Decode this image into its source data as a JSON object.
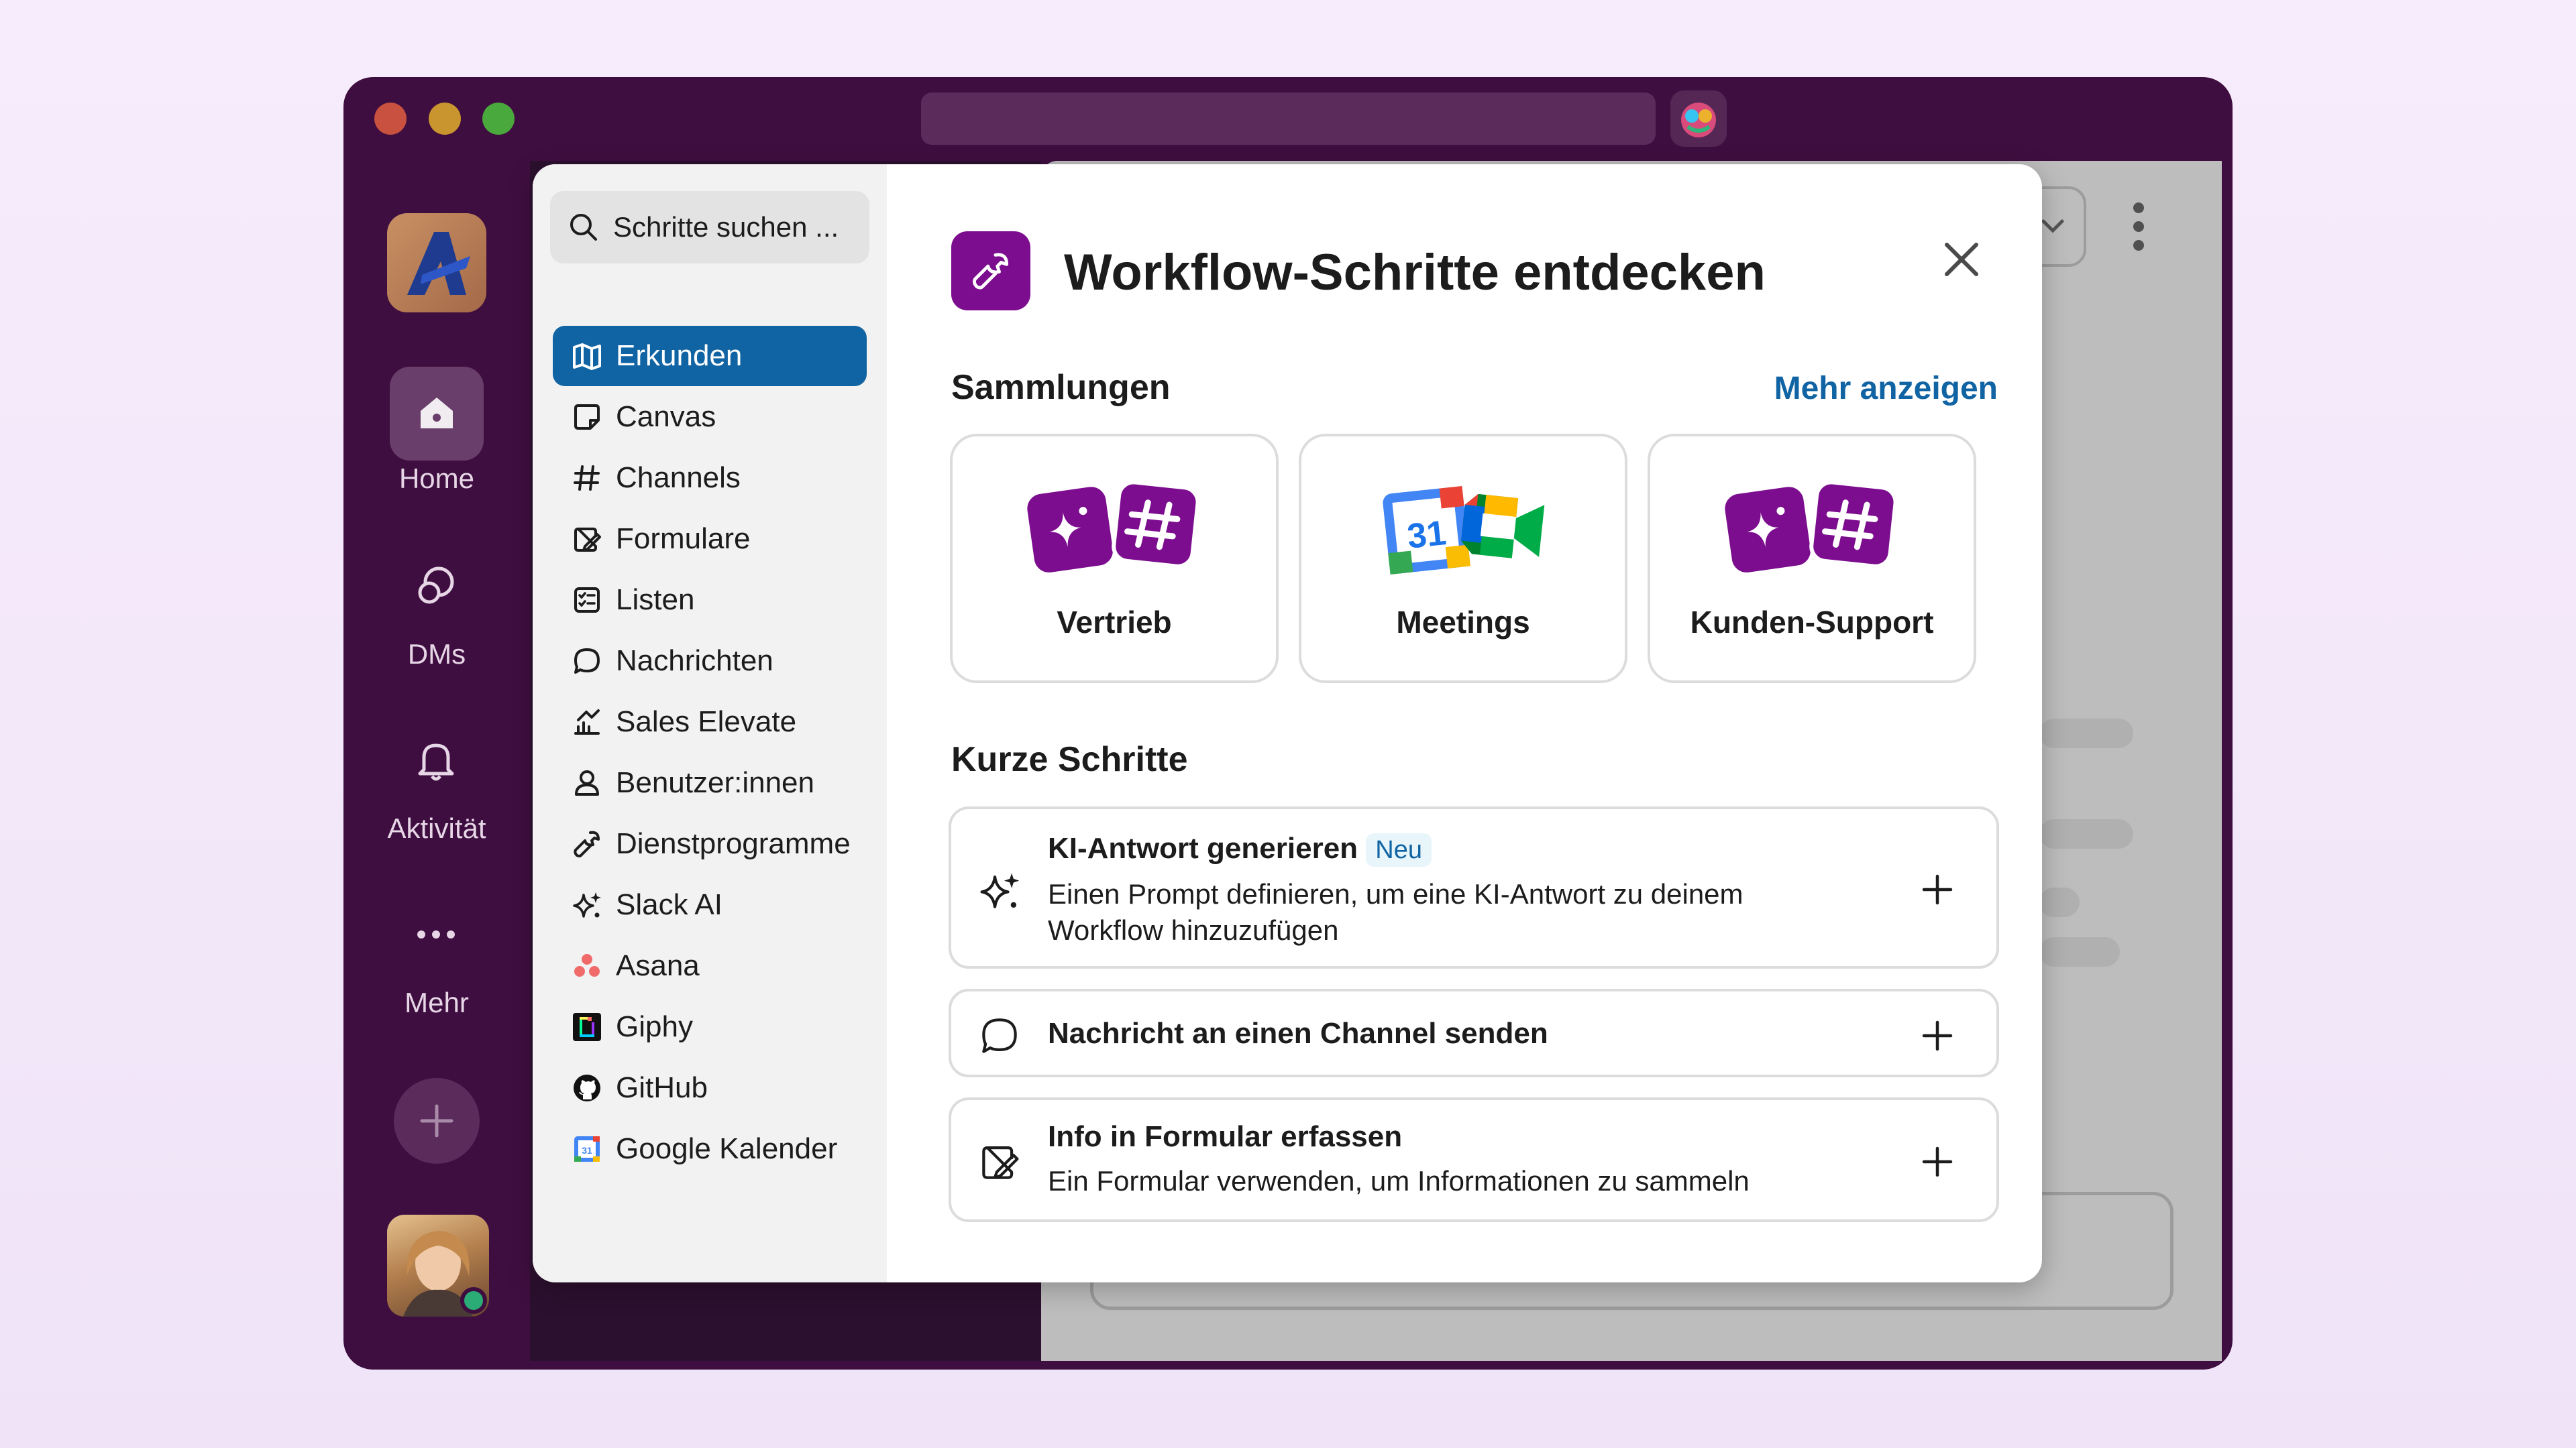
{
  "rail": {
    "items": [
      {
        "label": "Home",
        "icon": "home-icon"
      },
      {
        "label": "DMs",
        "icon": "dm-bubbles-icon"
      },
      {
        "label": "Aktivität",
        "icon": "bell-icon"
      },
      {
        "label": "Mehr",
        "icon": "more-dots-icon"
      }
    ]
  },
  "modal": {
    "search_placeholder": "Schritte suchen ...",
    "nav": [
      {
        "label": "Erkunden",
        "icon": "map-icon",
        "active": true
      },
      {
        "label": "Canvas",
        "icon": "canvas-icon"
      },
      {
        "label": "Channels",
        "icon": "hash-icon"
      },
      {
        "label": "Formulare",
        "icon": "form-icon"
      },
      {
        "label": "Listen",
        "icon": "list-icon"
      },
      {
        "label": "Nachrichten",
        "icon": "message-icon"
      },
      {
        "label": "Sales Elevate",
        "icon": "sales-elevate-icon"
      },
      {
        "label": "Benutzer:innen",
        "icon": "user-icon"
      },
      {
        "label": "Dienstprogramme",
        "icon": "wrench-icon"
      },
      {
        "label": "Slack AI",
        "icon": "sparkle-icon"
      },
      {
        "label": "Asana",
        "icon": "asana-icon"
      },
      {
        "label": "Giphy",
        "icon": "giphy-icon"
      },
      {
        "label": "GitHub",
        "icon": "github-icon"
      },
      {
        "label": "Google Kalender",
        "icon": "google-calendar-icon"
      }
    ],
    "title": "Workflow-Schritte entdecken",
    "collections_heading": "Sammlungen",
    "more_link": "Mehr anzeigen",
    "collections": [
      {
        "label": "Vertrieb"
      },
      {
        "label": "Meetings"
      },
      {
        "label": "Kunden-Support"
      }
    ],
    "quick_heading": "Kurze Schritte",
    "steps": [
      {
        "title": "KI-Antwort generieren",
        "badge": "Neu",
        "desc": "Einen Prompt definieren, um eine KI-Antwort zu deinem Workflow hinzuzufügen",
        "icon": "sparkle-icon"
      },
      {
        "title": "Nachricht an einen Channel senden",
        "icon": "message-icon"
      },
      {
        "title": "Info in Formular erfassen",
        "desc": "Ein Formular verwenden, um Informationen zu sammeln",
        "icon": "form-icon"
      }
    ],
    "calendar_day": "31"
  },
  "colors": {
    "window_bg": "#3f0e40",
    "accent": "#1164a3",
    "workflow_purple": "#7c0d8f"
  }
}
